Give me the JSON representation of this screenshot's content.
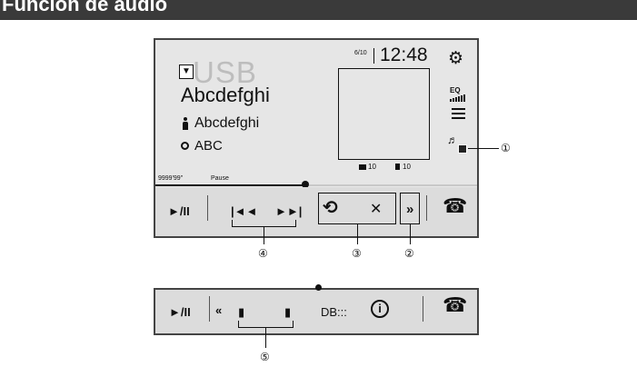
{
  "header": {
    "title": "Función de audio"
  },
  "now_playing": {
    "source_dropdown_glyph": "▼",
    "source": "USB",
    "title": "Abcdefghi",
    "artist": "Abcdefghi",
    "album": "ABC",
    "track_count": "6/10",
    "clock": "12:48",
    "folder_count": "10",
    "file_count": "10",
    "time_played": "9999'99\"",
    "status": "Pause",
    "progress": 0.47
  },
  "side_icons": {
    "settings": "⚙",
    "eq": "EQ",
    "music_note": "♬"
  },
  "bar1": {
    "play_pause": "►/II",
    "prev": "|◄◄",
    "next": "►►|",
    "repeat": "⟲",
    "shuffle": "✕",
    "more": "»",
    "phone": "☎"
  },
  "bar2": {
    "play_pause": "►/II",
    "back": "«",
    "left_icon": "▮",
    "right_icon": "▮",
    "db_label": "DB:::",
    "info": "i",
    "phone": "☎"
  },
  "callouts": {
    "c1": "①",
    "c2": "②",
    "c3": "③",
    "c4": "④",
    "c5": "⑤"
  },
  "icons": [
    "gear-icon",
    "eq-icon",
    "list-icon",
    "music-icon",
    "repeat-icon",
    "shuffle-icon",
    "phone-icon",
    "info-icon",
    "folder-icon",
    "file-icon"
  ]
}
